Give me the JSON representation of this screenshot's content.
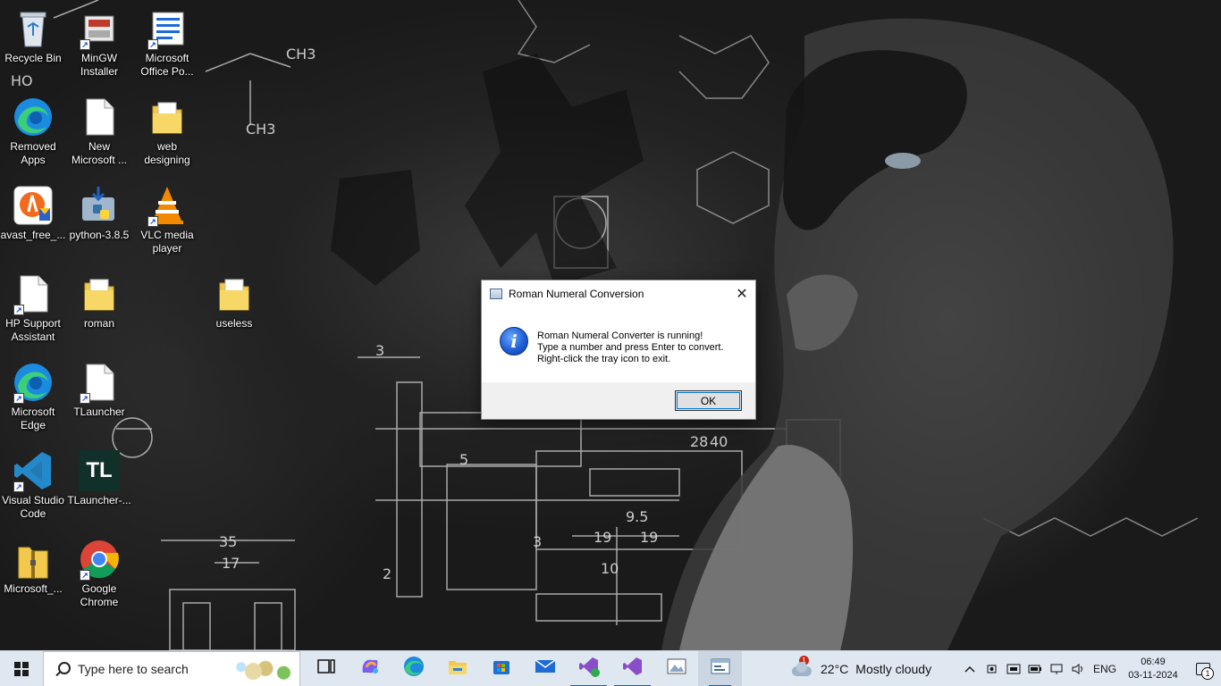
{
  "desktop": {
    "icons": [
      {
        "label": "Recycle Bin",
        "icon": "recycle-bin-icon",
        "shortcut": false
      },
      {
        "label": "MinGW Installer",
        "icon": "installer-icon",
        "shortcut": true
      },
      {
        "label": "Microsoft Office Po...",
        "icon": "office-doc-icon",
        "shortcut": true
      },
      {
        "label": "Removed Apps",
        "icon": "edge-icon",
        "shortcut": false
      },
      {
        "label": "New Microsoft ...",
        "icon": "document-icon",
        "shortcut": false
      },
      {
        "label": "web designing",
        "icon": "folder-icon",
        "shortcut": false
      },
      {
        "label": "avast_free_...",
        "icon": "avast-icon",
        "shortcut": false
      },
      {
        "label": "python-3.8.5",
        "icon": "python-installer-icon",
        "shortcut": false
      },
      {
        "label": "VLC media player",
        "icon": "vlc-icon",
        "shortcut": true
      },
      {
        "label": "HP Support Assistant",
        "icon": "document-icon",
        "shortcut": true
      },
      {
        "label": "roman",
        "icon": "folder-icon",
        "shortcut": false
      },
      {
        "label": "useless",
        "icon": "folder-icon",
        "shortcut": false
      },
      {
        "label": "Microsoft Edge",
        "icon": "edge-icon",
        "shortcut": true
      },
      {
        "label": "TLauncher",
        "icon": "document-icon",
        "shortcut": true
      },
      {
        "label": "Visual Studio Code",
        "icon": "vscode-icon",
        "shortcut": true
      },
      {
        "label": "TLauncher-...",
        "icon": "tlauncher-icon",
        "shortcut": false
      },
      {
        "label": "Microsoft_...",
        "icon": "zip-folder-icon",
        "shortcut": false
      },
      {
        "label": "Google Chrome",
        "icon": "chrome-icon",
        "shortcut": true
      }
    ],
    "tl_logo_text": "TL"
  },
  "dialog": {
    "title": "Roman Numeral Conversion",
    "close_glyph": "✕",
    "info_glyph": "i",
    "message_lines": [
      "Roman Numeral Converter is running!",
      "Type a number and press Enter to convert.",
      "Right-click the tray icon to exit."
    ],
    "ok_label": "OK"
  },
  "taskbar": {
    "search_placeholder": "Type here to search",
    "apps": [
      {
        "name": "task-view-icon"
      },
      {
        "name": "copilot-icon"
      },
      {
        "name": "edge-icon"
      },
      {
        "name": "file-explorer-icon"
      },
      {
        "name": "microsoft-store-icon"
      },
      {
        "name": "mail-icon"
      },
      {
        "name": "visual-studio-preview-icon"
      },
      {
        "name": "visual-studio-icon"
      },
      {
        "name": "photo-viewer-icon"
      },
      {
        "name": "roman-converter-app-icon"
      }
    ],
    "weather": {
      "badge": "1",
      "temp": "22°C",
      "condition": "Mostly cloudy"
    },
    "tray": {
      "chevron": "^",
      "language": "ENG",
      "time": "06:49",
      "date": "03-11-2024",
      "notification_count": "1"
    },
    "colors": {
      "taskbar_bg": "#dfe8f1",
      "accent": "#0067c0"
    }
  }
}
